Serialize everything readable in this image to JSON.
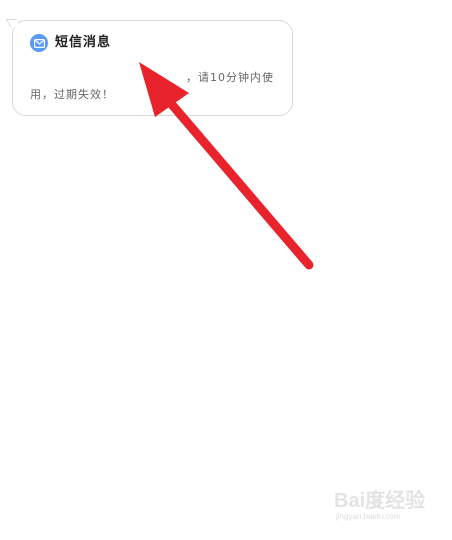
{
  "message": {
    "title": "短信消息",
    "icon": "mail-icon",
    "line1": "，请10分钟内使",
    "line2": "用，过期失效！"
  },
  "annotation": {
    "arrow_color": "#e8232b"
  },
  "watermark": {
    "brand": "Bai度经验",
    "domain": "jingyan.baidu.com"
  },
  "colors": {
    "icon_bg": "#5b9cf2",
    "bubble_border": "#d9d9d9"
  }
}
